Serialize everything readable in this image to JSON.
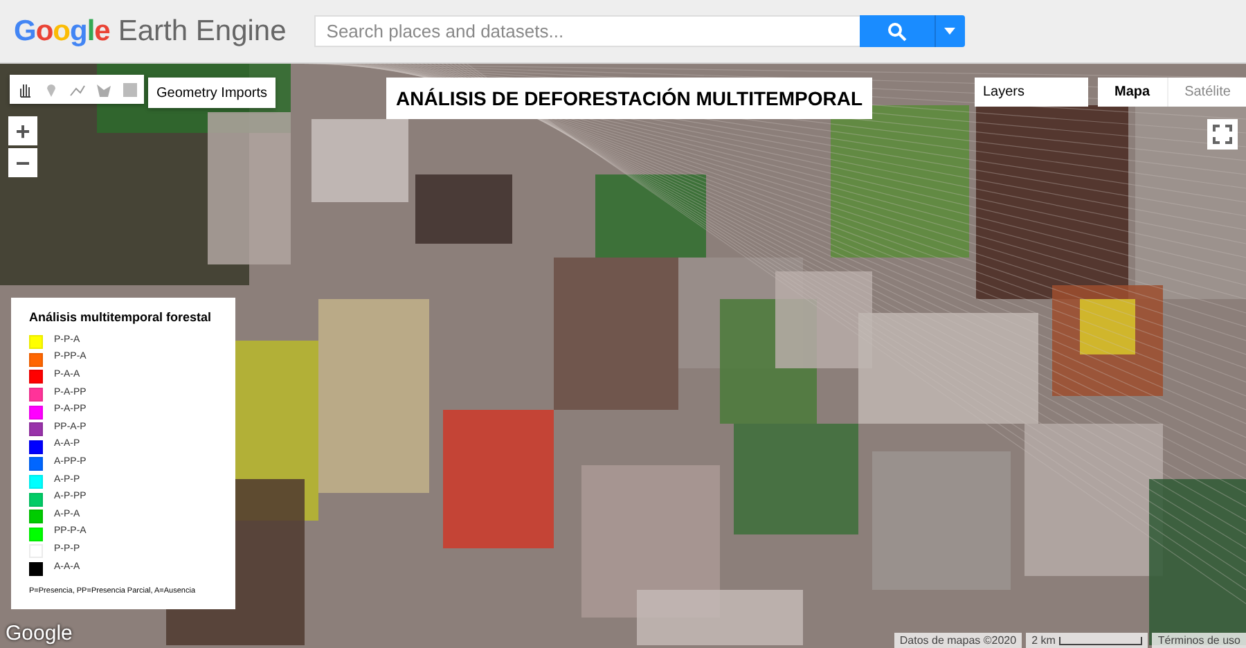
{
  "header": {
    "logo_google": "Google",
    "logo_product": "Earth Engine",
    "search": {
      "placeholder": "Search places and datasets..."
    }
  },
  "map": {
    "geometry_imports": "Geometry Imports",
    "title": "ANÁLISIS DE DEFORESTACIÓN MULTITEMPORAL",
    "layers": "Layers",
    "map_types": [
      {
        "label": "Mapa",
        "selected": true
      },
      {
        "label": "Satélite",
        "selected": false
      }
    ],
    "zoom_in": "+",
    "zoom_out": "−",
    "legend": {
      "title": "Análisis multitemporal forestal",
      "items": [
        {
          "label": "P-P-A",
          "color": "#ffff00"
        },
        {
          "label": "P-PP-A",
          "color": "#ff6600"
        },
        {
          "label": "P-A-A",
          "color": "#ff0000"
        },
        {
          "label": "P-A-PP",
          "color": "#ff3399"
        },
        {
          "label": "P-A-PP",
          "color": "#ff00ff"
        },
        {
          "label": "PP-A-P",
          "color": "#9933aa"
        },
        {
          "label": "A-A-P",
          "color": "#0000ff"
        },
        {
          "label": "A-PP-P",
          "color": "#0066ff"
        },
        {
          "label": "A-P-P",
          "color": "#00ffff"
        },
        {
          "label": "A-P-PP",
          "color": "#00cc66"
        },
        {
          "label": "A-P-A",
          "color": "#00cc00"
        },
        {
          "label": "PP-P-A",
          "color": "#00ff00"
        },
        {
          "label": "P-P-P",
          "color": "#ffffff"
        },
        {
          "label": "A-A-A",
          "color": "#000000"
        }
      ],
      "note": "P=Presencia, PP=Presencia Parcial, A=Ausencia"
    },
    "google_logo": "Google",
    "attribution": "Datos de mapas ©2020",
    "scale": "2 km",
    "terms": "Términos de uso"
  }
}
